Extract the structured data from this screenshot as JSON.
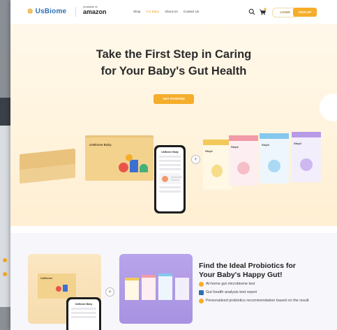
{
  "header": {
    "logo": "UsBiome",
    "amazon_small": "Available at",
    "amazon_big": "amazon",
    "nav": [
      {
        "label": "Shop",
        "active": false
      },
      {
        "label": "For Baby",
        "active": true
      },
      {
        "label": "About Us",
        "active": false
      },
      {
        "label": "Contact Us",
        "active": false
      }
    ],
    "login_label": "LOGIN",
    "signup_label": "SIGN UP"
  },
  "hero": {
    "title_line1": "Take the First Step in Caring",
    "title_line2": "for Your Baby's Gut Health",
    "cta_label": "GET STARTED",
    "box_label": "UsBiome Baby",
    "phone_header": "UsBiome Baby",
    "product_boxes": [
      {
        "label": "Step1",
        "cap": "#f3c95a"
      },
      {
        "label": "Step2",
        "cap": "#f29aa8"
      },
      {
        "label": "Step3",
        "cap": "#84c8ee"
      },
      {
        "label": "Step4",
        "cap": "#b79be6"
      }
    ]
  },
  "section2": {
    "title_line1": "Find the Ideal Probiotics for",
    "title_line2": "Your Baby's Happy Gut!",
    "card_label": "UsBiome",
    "phone_header": "UsBiome Baby",
    "items": [
      {
        "text": "At-home gut microbiome test",
        "color": "#f5ad2a"
      },
      {
        "text": "Gut health analysis test report",
        "color": "#2f6fb3"
      },
      {
        "text": "Personalized probiotics recommendation based on the result",
        "color": "#f5ad2a"
      }
    ]
  },
  "colors": {
    "accent": "#f5ad2a",
    "brand_blue": "#2f6fb3"
  }
}
